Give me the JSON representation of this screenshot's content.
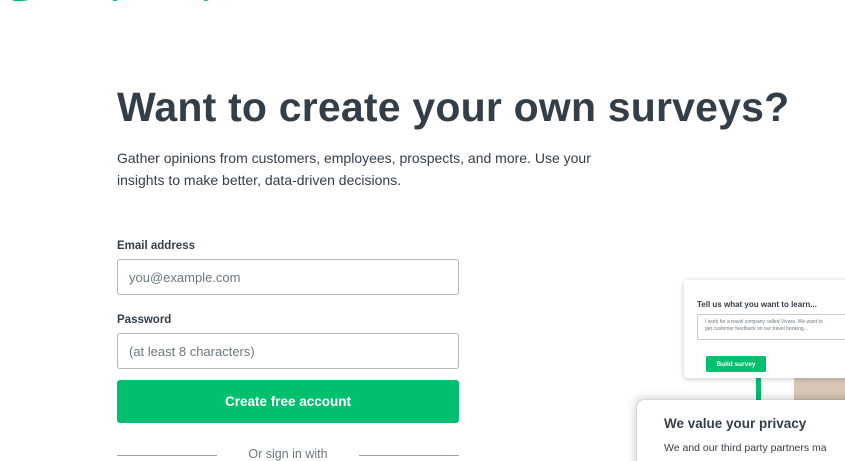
{
  "brand": {
    "logo_icon": "surveymonkey-logo-icon",
    "color": "#00bf6f"
  },
  "hero": {
    "title": "Want to create your own surveys?",
    "subtitle_line1": "Gather opinions from customers, employees, prospects, and more. Use your",
    "subtitle_line2": "insights to make better, data-driven decisions."
  },
  "form": {
    "email_label": "Email address",
    "email_placeholder": "you@example.com",
    "password_label": "Password",
    "password_placeholder": "(at least 8 characters)",
    "submit_label": "Create free account",
    "divider_text": "Or sign in with"
  },
  "illustration": {
    "card_title": "Tell us what you want to learn...",
    "card_text_line1": "I work for a travel company called Vivara. We want to",
    "card_text_line2": "get customer feedback on our travel booking...",
    "card_button": "Build survey"
  },
  "privacy": {
    "title": "We value your privacy",
    "text": "We and our third party partners ma"
  },
  "colors": {
    "accent": "#00bf6f",
    "text": "#333e48",
    "muted": "#6b787f"
  }
}
